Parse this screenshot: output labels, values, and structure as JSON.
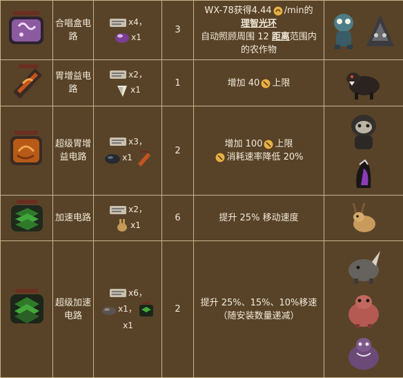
{
  "rows": [
    {
      "name": "合唱盒电路",
      "materials": [
        {
          "icon": "bio-data-icon",
          "qty": "x4",
          "sep": "，"
        },
        {
          "icon": "purple-gem-icon",
          "qty": "x1",
          "sep": ""
        }
      ],
      "slots": "3",
      "effect": {
        "pre": "WX-78获得4.44",
        "post": "/min的",
        "bold": "理智光环",
        "line3_pre": "自动照顾周围 12 ",
        "line3_bold": "距离",
        "line3_post": "范围内",
        "line4": "的农作物"
      },
      "sources": [
        "merm-icon",
        "ancient-guardian-icon"
      ]
    },
    {
      "name": "胃增益电路",
      "materials": [
        {
          "icon": "bio-data-icon",
          "qty": "x2",
          "sep": "，"
        },
        {
          "icon": "tooth-icon",
          "qty": "x1",
          "sep": ""
        }
      ],
      "slots": "1",
      "effect": {
        "pre": "增加 40",
        "post": "上限"
      },
      "sources": [
        "hound-icon"
      ]
    },
    {
      "name": "超级胃增益电路",
      "materials": [
        {
          "icon": "bio-data-icon",
          "qty": "x3",
          "sep": "，"
        },
        {
          "icon": "dark-gem-icon",
          "qty": "x1",
          "sep": ""
        },
        {
          "icon": "stomach-circuit-icon",
          "qty": "",
          "sep": ""
        }
      ],
      "slots": "2",
      "effect": {
        "line1_pre": "增加 100",
        "line1_post": "上限",
        "line2_post": "消耗速率降低 20%"
      },
      "sources": [
        "gorilla-icon",
        "purple-tentacle-icon"
      ]
    },
    {
      "name": "加速电路",
      "materials": [
        {
          "icon": "bio-data-icon",
          "qty": "x2",
          "sep": "，"
        },
        {
          "icon": "rabbit-icon",
          "qty": "x1",
          "sep": ""
        }
      ],
      "slots": "6",
      "effect": {
        "text": "提升 25% 移动速度"
      },
      "sources": [
        "jackalope-icon"
      ]
    },
    {
      "name": "超级加速电路",
      "materials": [
        {
          "icon": "bio-data-icon",
          "qty": "x6",
          "sep": "，"
        },
        {
          "icon": "rock-icon",
          "qty": "x1",
          "sep": "，"
        },
        {
          "icon": "speed-circuit-icon",
          "qty": "",
          "sep": ""
        },
        {
          "icon": "",
          "qty": "x1",
          "sep": ""
        }
      ],
      "slots": "2",
      "effect": {
        "line1": "提升 25%、15%、10%移速",
        "line2": "（随安装数量递减）"
      },
      "sources": [
        "rhino-icon",
        "pink-beast-icon",
        "purple-beast-icon"
      ]
    }
  ]
}
